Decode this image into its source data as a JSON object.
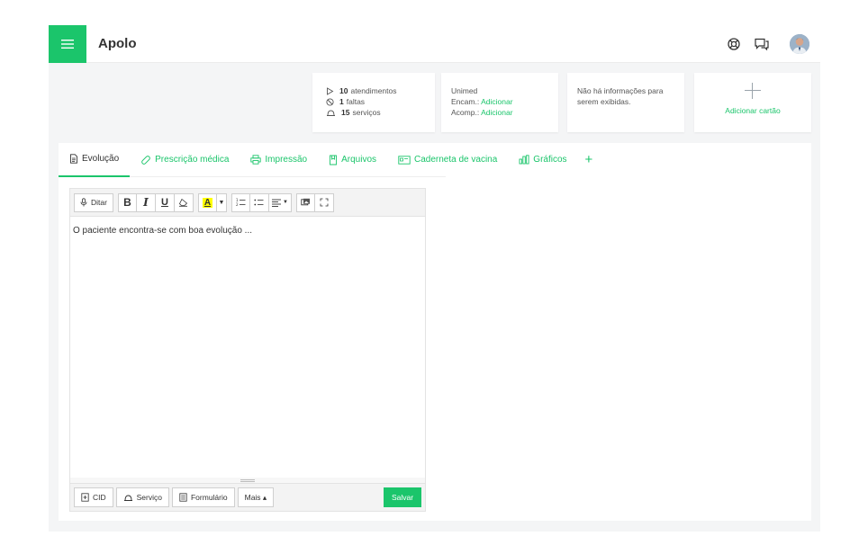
{
  "colors": {
    "accent": "#1bc56b",
    "highlight": "#ffff00"
  },
  "header": {
    "title": "Apolo",
    "icons": [
      "menu-icon",
      "lifebuoy-icon",
      "chat-icon",
      "avatar"
    ]
  },
  "cards": {
    "stats": [
      {
        "icon": "play-icon",
        "count": "10",
        "label": "atendimentos"
      },
      {
        "icon": "ban-icon",
        "count": "1",
        "label": "faltas"
      },
      {
        "icon": "bell-icon",
        "count": "15",
        "label": "serviços"
      }
    ],
    "plan": {
      "name": "Unimed",
      "encam_label": "Encam.:",
      "encam_link": "Adicionar",
      "acomp_label": "Acomp.:",
      "acomp_link": "Adicionar"
    },
    "info": {
      "text": "Não há informações para serem exibidas."
    },
    "add": {
      "label": "Adicionar cartão"
    }
  },
  "tabs": [
    {
      "label": "Evolução",
      "icon": "document-icon",
      "active": true
    },
    {
      "label": "Prescrição médica",
      "icon": "pill-icon"
    },
    {
      "label": "Impressão",
      "icon": "printer-icon"
    },
    {
      "label": "Arquivos",
      "icon": "file-icon"
    },
    {
      "label": "Caderneta de vacina",
      "icon": "card-icon"
    },
    {
      "label": "Gráficos",
      "icon": "bar-chart-icon"
    }
  ],
  "toolbar": {
    "dictate": "Ditar",
    "bold": "B",
    "italic": "I",
    "underline": "U",
    "color": "A"
  },
  "editor": {
    "content": "O paciente encontra-se com boa evolução ..."
  },
  "footer": {
    "cid": "CID",
    "servico": "Serviço",
    "formulario": "Formulário",
    "mais": "Mais ▴",
    "save": "Salvar"
  }
}
